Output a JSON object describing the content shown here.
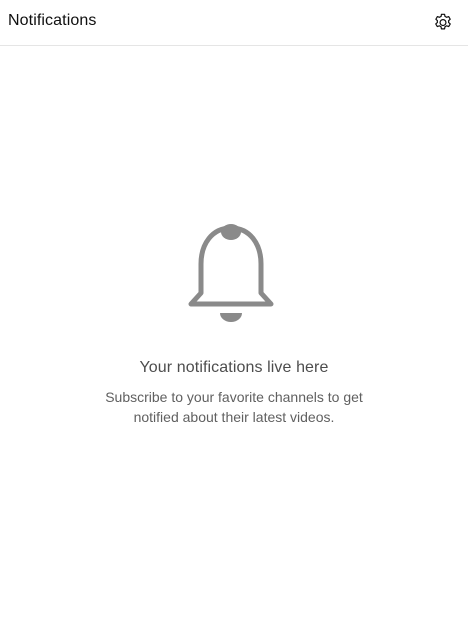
{
  "header": {
    "title": "Notifications",
    "settings_icon": "gear-icon"
  },
  "empty_state": {
    "icon": "bell-icon",
    "title": "Your notifications live here",
    "subtitle": "Subscribe to your favorite channels to get notified about their latest videos."
  },
  "colors": {
    "icon": "#8a8a8a",
    "divider": "#e5e5e5",
    "title_text": "#0f0f0f",
    "muted_text": "#606060"
  }
}
